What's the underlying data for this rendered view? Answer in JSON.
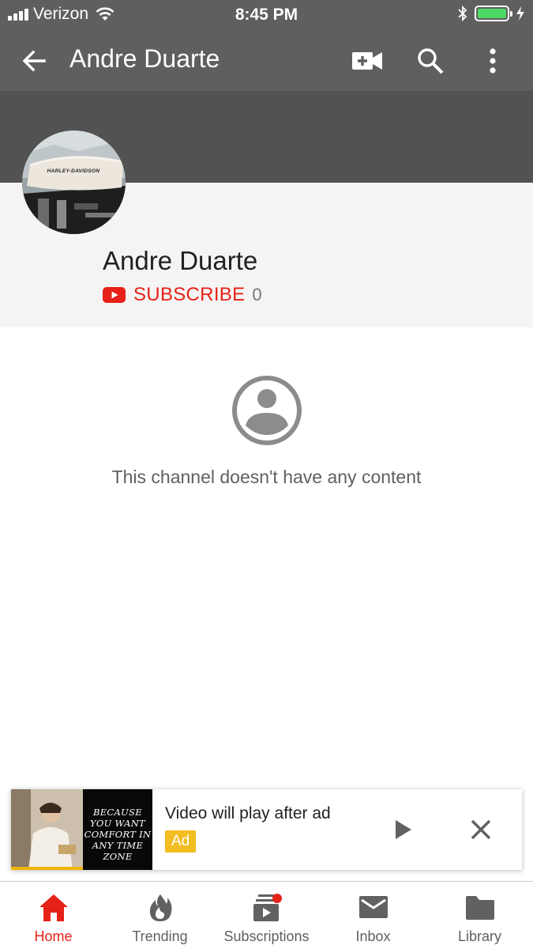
{
  "status_bar": {
    "carrier": "Verizon",
    "time": "8:45 PM"
  },
  "app_bar": {
    "title": "Andre Duarte",
    "icons": [
      "back-arrow-icon",
      "video-add-icon",
      "search-icon",
      "more-vert-icon"
    ]
  },
  "channel": {
    "name": "Andre Duarte",
    "subscribe_label": "SUBSCRIBE",
    "subscriber_count": "0",
    "avatar_text": "HARLEY-DAVIDSON"
  },
  "empty_state": {
    "message": "This channel doesn't have any content"
  },
  "ad_player": {
    "title": "Video will play after ad",
    "badge": "Ad",
    "poster_lines": [
      "BECAUSE",
      "YOU WANT",
      "COMFORT IN",
      "ANY TIME ZONE"
    ],
    "progress": 1.0
  },
  "bottom_nav": {
    "items": [
      {
        "label": "Home",
        "active": true
      },
      {
        "label": "Trending",
        "active": false
      },
      {
        "label": "Subscriptions",
        "active": false
      },
      {
        "label": "Inbox",
        "active": false
      },
      {
        "label": "Library",
        "active": false
      }
    ]
  },
  "colors": {
    "appbar": "#5f5f5f",
    "accent_red": "#e62117",
    "ad_badge": "#f2bd20"
  }
}
